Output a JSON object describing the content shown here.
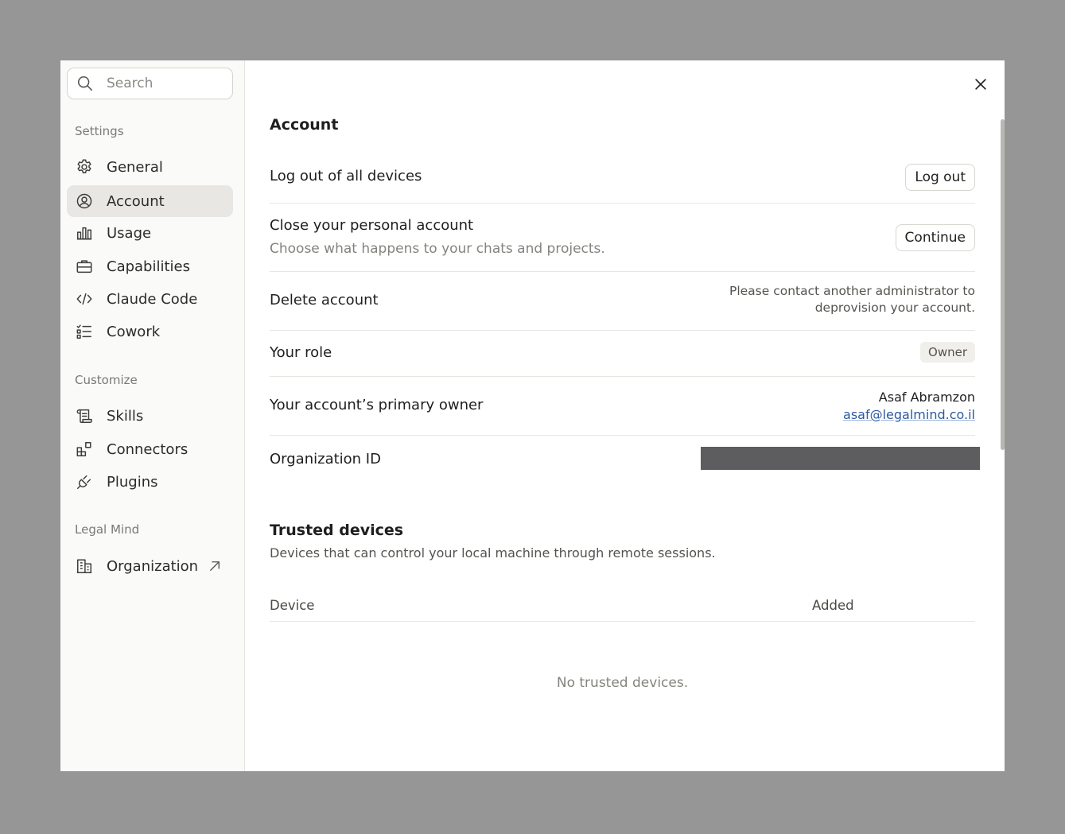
{
  "search": {
    "placeholder": "Search"
  },
  "sidebar": {
    "sections": [
      {
        "label": "Settings"
      },
      {
        "label": "Customize"
      },
      {
        "label": "Legal Mind"
      }
    ],
    "items": [
      {
        "label": "General",
        "icon": "gear-icon"
      },
      {
        "label": "Account",
        "icon": "user-circle-icon",
        "active": true
      },
      {
        "label": "Usage",
        "icon": "bar-chart-icon"
      },
      {
        "label": "Capabilities",
        "icon": "briefcase-icon"
      },
      {
        "label": "Claude Code",
        "icon": "code-icon"
      },
      {
        "label": "Cowork",
        "icon": "checklist-icon"
      },
      {
        "label": "Skills",
        "icon": "scroll-icon"
      },
      {
        "label": "Connectors",
        "icon": "blocks-icon"
      },
      {
        "label": "Plugins",
        "icon": "plug-icon"
      },
      {
        "label": "Organization",
        "icon": "building-icon",
        "external": true
      }
    ]
  },
  "account": {
    "title": "Account",
    "logout": {
      "label": "Log out of all devices",
      "button": "Log out"
    },
    "close": {
      "label": "Close your personal account",
      "description": "Choose what happens to your chats and projects.",
      "button": "Continue"
    },
    "delete": {
      "label": "Delete account",
      "message_line1": "Please contact another administrator to",
      "message_line2": "deprovision your account."
    },
    "role": {
      "label": "Your role",
      "value": "Owner"
    },
    "primary_owner": {
      "label": "Your account’s primary owner",
      "name": "Asaf Abramzon",
      "email": "asaf@legalmind.co.il"
    },
    "org_id": {
      "label": "Organization ID"
    }
  },
  "trusted_devices": {
    "title": "Trusted devices",
    "description": "Devices that can control your local machine through remote sessions.",
    "columns": [
      "Device",
      "Added"
    ],
    "empty_text": "No trusted devices."
  },
  "colors": {
    "backdrop": "#969696",
    "active_item": "#e8e7e3",
    "link": "#2c5aa0",
    "redaction": "#5d5d60"
  }
}
